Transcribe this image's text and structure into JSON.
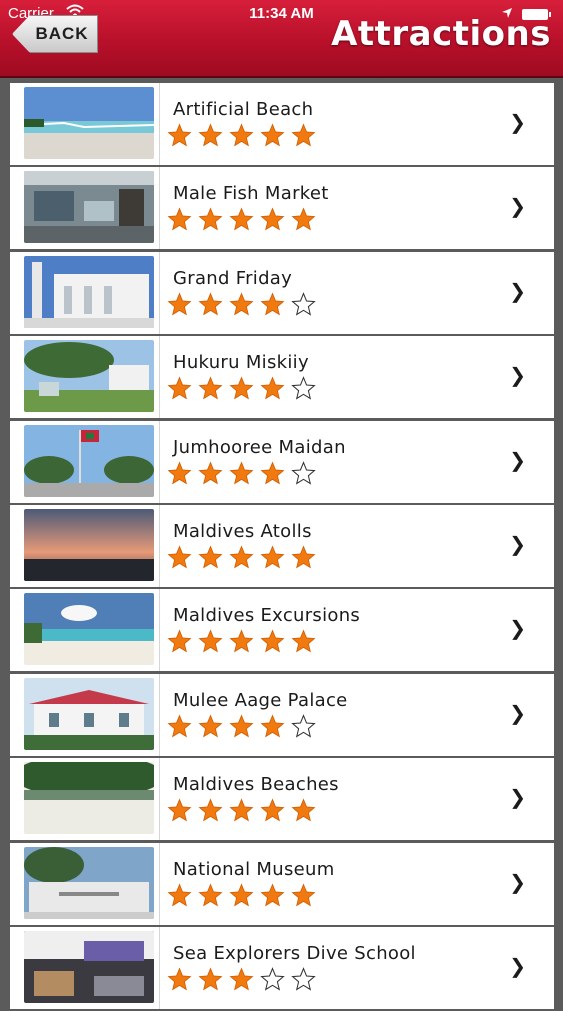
{
  "status_bar": {
    "carrier": "Carrier",
    "time": "11:34 AM"
  },
  "navbar": {
    "back_label": "BACK",
    "title": "Attractions"
  },
  "colors": {
    "nav_red": "#c4142f",
    "star_orange": "#f07a10",
    "background": "#5b5b5b"
  },
  "attractions": [
    {
      "name": "Artificial Beach",
      "rating": 5,
      "thumb_icon": "beach-photo"
    },
    {
      "name": "Male Fish Market",
      "rating": 5,
      "thumb_icon": "market-photo"
    },
    {
      "name": "Grand Friday",
      "rating": 4,
      "thumb_icon": "mosque-photo"
    },
    {
      "name": "Hukuru Miskiiy",
      "rating": 4,
      "thumb_icon": "mosque-garden-photo"
    },
    {
      "name": "Jumhooree Maidan",
      "rating": 4,
      "thumb_icon": "square-flag-photo"
    },
    {
      "name": "Maldives Atolls",
      "rating": 5,
      "thumb_icon": "sunset-sea-photo"
    },
    {
      "name": "Maldives Excursions",
      "rating": 5,
      "thumb_icon": "excursion-beach-photo"
    },
    {
      "name": "Mulee Aage Palace",
      "rating": 4,
      "thumb_icon": "palace-photo"
    },
    {
      "name": "Maldives Beaches",
      "rating": 5,
      "thumb_icon": "tropical-beach-photo"
    },
    {
      "name": "National Museum",
      "rating": 5,
      "thumb_icon": "museum-photo"
    },
    {
      "name": "Sea Explorers Dive School",
      "rating": 3,
      "thumb_icon": "dive-school-photo"
    }
  ],
  "row_chevron": "❯"
}
